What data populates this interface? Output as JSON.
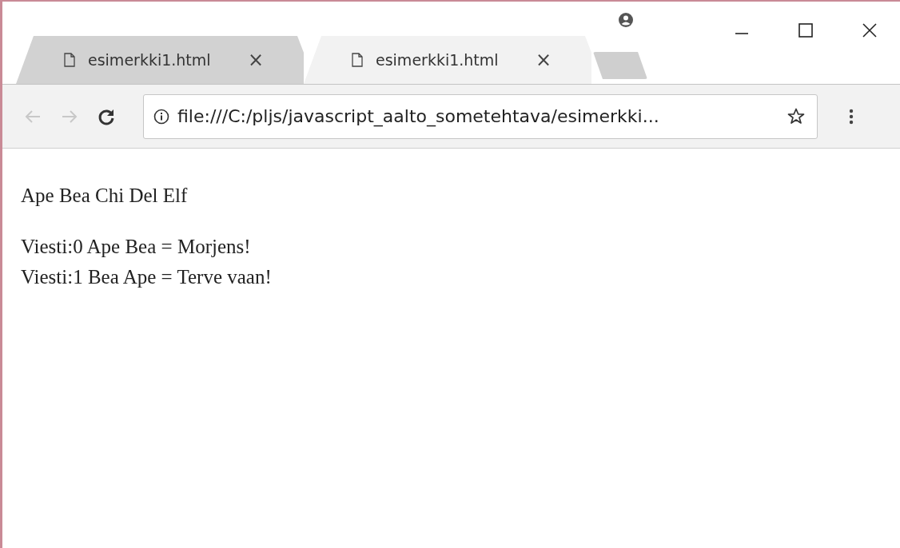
{
  "tabs": [
    {
      "title": "esimerkki1.html",
      "close": "×",
      "selected": false
    },
    {
      "title": "esimerkki1.html",
      "close": "×",
      "selected": true
    }
  ],
  "toolbar": {
    "back_disabled": true,
    "forward_disabled": true,
    "reload_disabled": false,
    "address": "file:///C:/pljs/javascript_aalto_sometehtava/esimerkki..."
  },
  "page": {
    "paragraphs": [
      [
        "Ape Bea Chi Del Elf"
      ],
      [
        "Viesti:0 Ape Bea = Morjens!",
        "Viesti:1 Bea Ape = Terve vaan!"
      ]
    ]
  }
}
